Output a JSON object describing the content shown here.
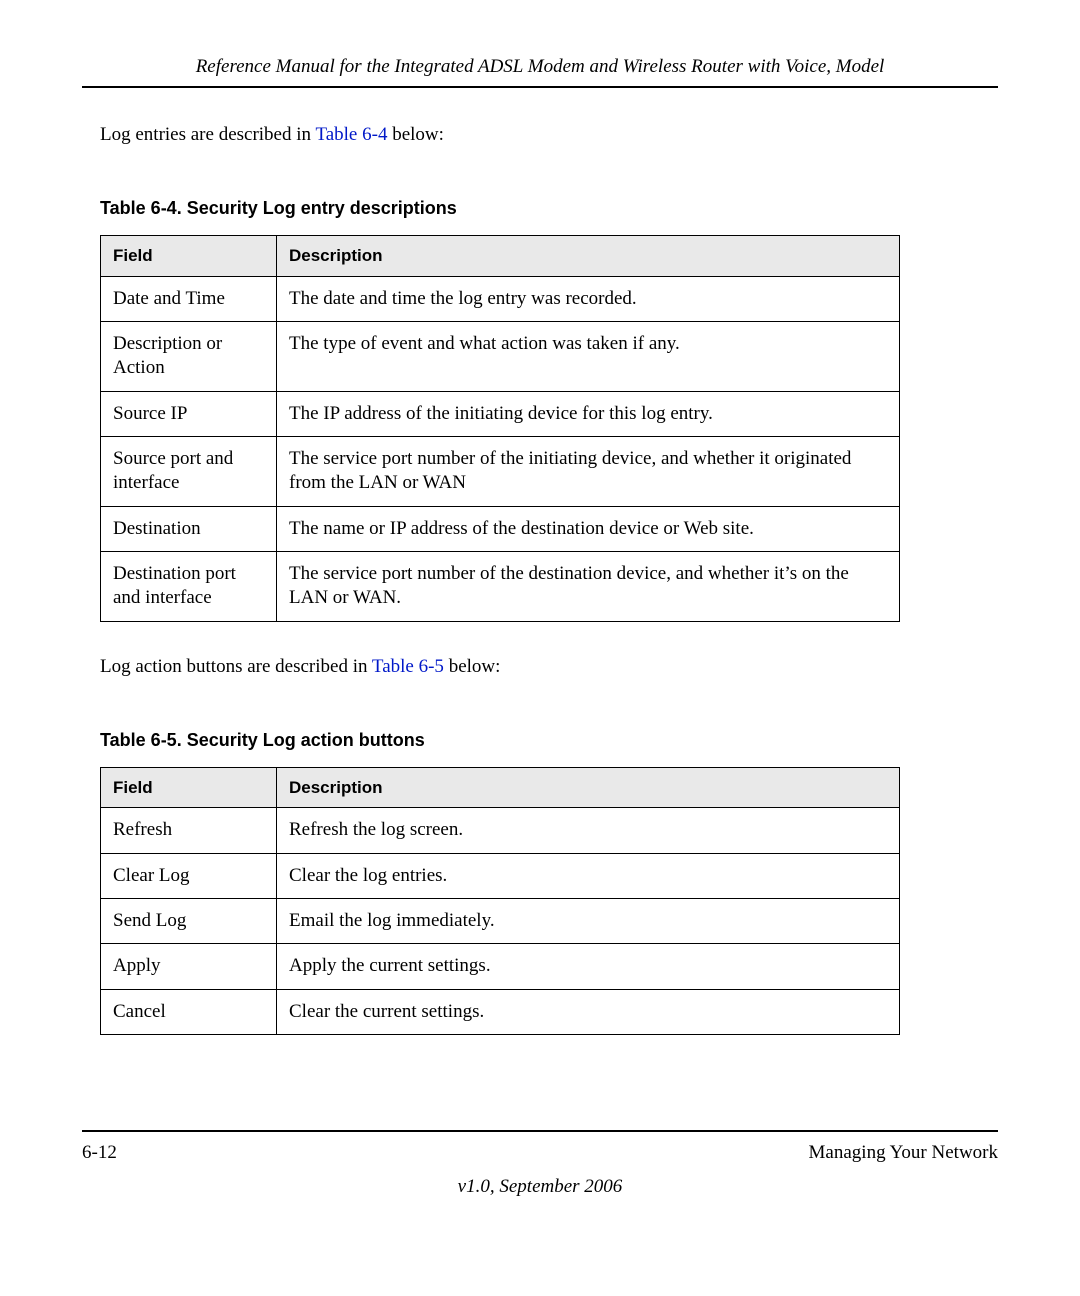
{
  "header": "Reference Manual for the Integrated ADSL Modem and Wireless Router with Voice, Model",
  "intro1": {
    "before": "Log entries are described in ",
    "link": "Table 6-4",
    "after": " below:"
  },
  "table1": {
    "caption": "Table 6-4. Security Log entry descriptions",
    "headers": [
      "Field",
      "Description"
    ],
    "rows": [
      {
        "field": "Date and Time",
        "desc": "The date and time the log entry was recorded."
      },
      {
        "field": "Description or Action",
        "desc": "The type of event and what action was taken if any."
      },
      {
        "field": "Source IP",
        "desc": "The IP address of the initiating device for this log entry."
      },
      {
        "field": "Source port and interface",
        "desc": "The service port number of the initiating device, and whether it originated from the LAN or WAN"
      },
      {
        "field": "Destination",
        "desc": "The name or IP address of the destination device or Web site."
      },
      {
        "field": "Destination port and interface",
        "desc": "The service port number of the destination device, and whether it’s on the LAN or WAN."
      }
    ]
  },
  "intro2": {
    "before": "Log action buttons are described in ",
    "link": "Table 6-5",
    "after": " below:"
  },
  "table2": {
    "caption": "Table 6-5. Security Log action buttons",
    "headers": [
      "Field",
      "Description"
    ],
    "rows": [
      {
        "field": "Refresh",
        "desc": "Refresh the log screen."
      },
      {
        "field": "Clear Log",
        "desc": "Clear the log entries."
      },
      {
        "field": "Send Log",
        "desc": "Email the log immediately."
      },
      {
        "field": "Apply",
        "desc": "Apply the current settings."
      },
      {
        "field": "Cancel",
        "desc": "Clear the current settings."
      }
    ]
  },
  "footer": {
    "pageNum": "6-12",
    "section": "Managing Your Network",
    "version": "v1.0, September 2006"
  }
}
